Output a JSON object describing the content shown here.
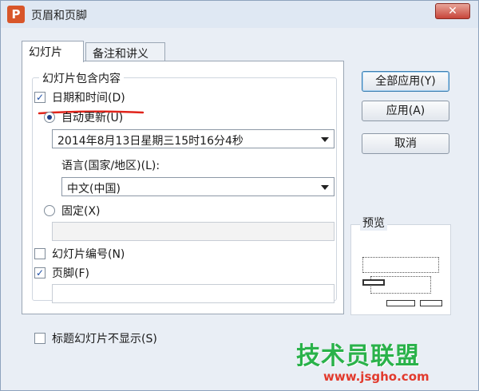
{
  "window": {
    "title": "页眉和页脚",
    "app_icon_text": "P",
    "close_label": "✕"
  },
  "tabs": [
    {
      "label": "幻灯片",
      "active": true
    },
    {
      "label": "备注和讲义",
      "active": false
    }
  ],
  "group": {
    "title": "幻灯片包含内容",
    "date_time": {
      "label": "日期和时间(D)",
      "checked": true
    },
    "auto_update": {
      "label": "自动更新(U)",
      "selected": true,
      "value": "2014年8月13日星期三15时16分4秒"
    },
    "language": {
      "label": "语言(国家/地区)(L):",
      "value": "中文(中国)"
    },
    "fixed": {
      "label": "固定(X)",
      "selected": false,
      "value": ""
    },
    "slide_number": {
      "label": "幻灯片编号(N)",
      "checked": false
    },
    "footer": {
      "label": "页脚(F)",
      "checked": true,
      "value": ""
    }
  },
  "hide_on_title": {
    "label": "标题幻灯片不显示(S)",
    "checked": false
  },
  "buttons": {
    "apply_all": "全部应用(Y)",
    "apply": "应用(A)",
    "cancel": "取消"
  },
  "preview": {
    "label": "预览"
  },
  "watermark": {
    "main": "技术员联盟",
    "url": "www.jsgho.com"
  },
  "colors": {
    "accent": "#1e3f8a",
    "annotation": "#e0241b",
    "watermark_green": "#2ab24a"
  }
}
